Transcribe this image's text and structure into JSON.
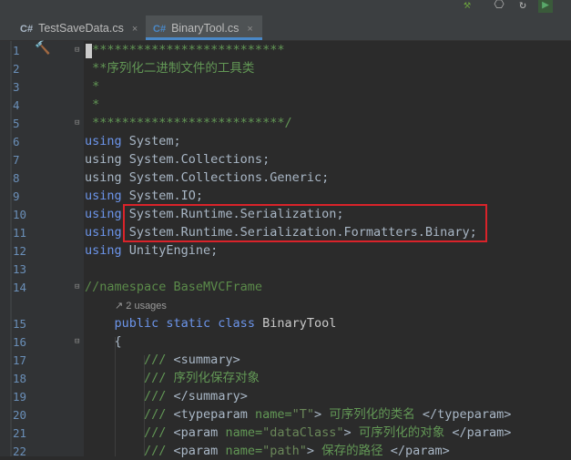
{
  "toolbar": {
    "buttons": [
      {
        "name": "build-hammer-icon",
        "glyph": "⚒"
      },
      {
        "name": "debug-attach-icon",
        "glyph": "⎔"
      },
      {
        "name": "refresh-icon",
        "glyph": "↻"
      },
      {
        "name": "run-icon",
        "glyph": "▶"
      }
    ]
  },
  "tabs": [
    {
      "badge": "C#",
      "label": "TestSaveData.cs",
      "close": "×",
      "active": false
    },
    {
      "badge": "C#",
      "label": "BinaryTool.cs",
      "close": "×",
      "active": true
    }
  ],
  "gutter": {
    "line_numbers": [
      "1",
      "2",
      "3",
      "4",
      "5",
      "6",
      "7",
      "8",
      "9",
      "10",
      "11",
      "12",
      "13",
      "14",
      "",
      "15",
      "16",
      "17",
      "18",
      "19",
      "20",
      "21",
      "22"
    ],
    "hammer_glyph": "🔨"
  },
  "code": {
    "usages": "↗ 2 usages",
    "lines": [
      {
        "indent": "",
        "parts": [
          [
            "cm",
            "/**************************"
          ]
        ]
      },
      {
        "indent": "",
        "parts": [
          [
            "cm",
            " **序列化二进制文件的工具类"
          ]
        ]
      },
      {
        "indent": "",
        "parts": [
          [
            "cm",
            " *"
          ]
        ]
      },
      {
        "indent": "",
        "parts": [
          [
            "cm",
            " *"
          ]
        ]
      },
      {
        "indent": "",
        "parts": [
          [
            "cm",
            " **************************/"
          ]
        ]
      },
      {
        "indent": "",
        "parts": [
          [
            "kw",
            "using"
          ],
          [
            "ns",
            " System;"
          ]
        ]
      },
      {
        "indent": "",
        "parts": [
          [
            "ns",
            "using System.Collections;"
          ]
        ]
      },
      {
        "indent": "",
        "parts": [
          [
            "ns",
            "using System.Collections.Generic;"
          ]
        ]
      },
      {
        "indent": "",
        "parts": [
          [
            "kw",
            "using"
          ],
          [
            "ns",
            " System.IO;"
          ]
        ]
      },
      {
        "indent": "",
        "parts": [
          [
            "kw",
            "using"
          ],
          [
            "ns",
            " System.Runtime.Serialization;"
          ]
        ]
      },
      {
        "indent": "",
        "parts": [
          [
            "kw",
            "using"
          ],
          [
            "ns",
            " System.Runtime.Serialization.Formatters.Binary;"
          ]
        ]
      },
      {
        "indent": "",
        "parts": [
          [
            "kw",
            "using"
          ],
          [
            "ns",
            " UnityEngine;"
          ]
        ]
      },
      {
        "indent": "",
        "parts": []
      },
      {
        "indent": "",
        "parts": [
          [
            "cmg",
            "//namespace BaseMVCFrame"
          ]
        ]
      },
      {
        "indent": "usages",
        "parts": []
      },
      {
        "indent": "    ",
        "parts": [
          [
            "kw",
            "public static class"
          ],
          [
            "ty",
            " BinaryTool"
          ]
        ]
      },
      {
        "indent": "    ",
        "parts": [
          [
            "ns",
            "{"
          ]
        ]
      },
      {
        "indent": "        ",
        "parts": [
          [
            "cm",
            "/// "
          ],
          [
            "tag",
            "<summary>"
          ]
        ]
      },
      {
        "indent": "        ",
        "parts": [
          [
            "cm",
            "/// 序列化保存对象"
          ]
        ]
      },
      {
        "indent": "        ",
        "parts": [
          [
            "cm",
            "/// "
          ],
          [
            "tag",
            "</summary>"
          ]
        ]
      },
      {
        "indent": "        ",
        "parts": [
          [
            "cm",
            "/// "
          ],
          [
            "tag",
            "<typeparam "
          ],
          [
            "cm",
            "name="
          ],
          [
            "str",
            "\"T\""
          ],
          [
            "tag",
            ">"
          ],
          [
            "cm",
            " 可序列化的类名 "
          ],
          [
            "tag",
            "</typeparam>"
          ]
        ]
      },
      {
        "indent": "        ",
        "parts": [
          [
            "cm",
            "/// "
          ],
          [
            "tag",
            "<param "
          ],
          [
            "cm",
            "name="
          ],
          [
            "str",
            "\"dataClass\""
          ],
          [
            "tag",
            ">"
          ],
          [
            "cm",
            " 可序列化的对象 "
          ],
          [
            "tag",
            "</param>"
          ]
        ]
      },
      {
        "indent": "        ",
        "parts": [
          [
            "cm",
            "/// "
          ],
          [
            "tag",
            "<param "
          ],
          [
            "cm",
            "name="
          ],
          [
            "str",
            "\"path\""
          ],
          [
            "tag",
            ">"
          ],
          [
            "cm",
            " 保存的路径 "
          ],
          [
            "tag",
            "</param>"
          ]
        ]
      }
    ]
  },
  "highlight_note": ""
}
